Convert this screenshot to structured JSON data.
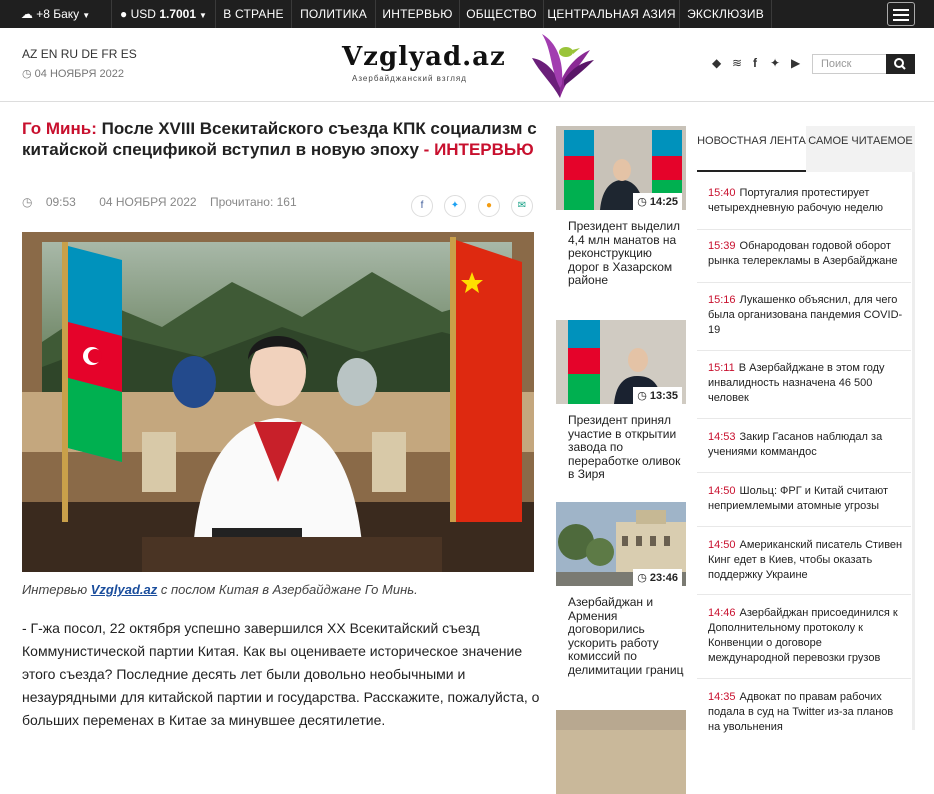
{
  "topbar": {
    "weather": "+8 Баку",
    "currency_label": "USD",
    "currency_value": "1.7001",
    "nav": [
      "В СТРАНЕ",
      "ПОЛИТИКА",
      "ИНТЕРВЬЮ",
      "ОБЩЕСТВО",
      "ЦЕНТРАЛЬНАЯ АЗИЯ",
      "ЭКСКЛЮЗИВ"
    ]
  },
  "header": {
    "languages": [
      "AZ",
      "EN",
      "RU",
      "DE",
      "FR",
      "ES"
    ],
    "date": "04 НОЯБРЯ 2022",
    "logo": "Vzglyad.az",
    "logo_sub": "Азербайджанский взгляд",
    "search_placeholder": "Поиск"
  },
  "article": {
    "author": "Го Минь:",
    "title": "После XVIII Всекитайского съезда КПК социализм с китайской спецификой вступил в новую эпоху",
    "dash": " - ",
    "rubric": "ИНТЕРВЬЮ",
    "time": "09:53",
    "date": "04 НОЯБРЯ 2022",
    "reads": "Прочитано: 161",
    "caption_pre": "Интервью ",
    "caption_link": "Vzglyad.az",
    "caption_post": " с послом Китая в Азербайджане Го Минь.",
    "body": "- Г-жа посол, 22 октября успешно завершился XX Всекитайский съезд Коммунистической партии Китая. Как вы оцениваете историческое значение этого съезда? Последние десять лет были довольно необычными и незаурядными для китайской партии и государства. Расскажите, пожалуйста, о больших переменах в Китае за минувшее десятилетие."
  },
  "middle": [
    {
      "time": "14:25",
      "text": "Президент выделил 4,4 млн манатов на реконструкцию дорог в Хазарском районе"
    },
    {
      "time": "13:35",
      "text": "Президент принял участие в открытии завода по переработке оливок в Зиря"
    },
    {
      "time": "23:46",
      "text": "Азербайджан и Армения договорились ускорить работу комиссий по делимитации границ"
    }
  ],
  "sidebar": {
    "tab_news": "НОВОСТНАЯ ЛЕНТА",
    "tab_popular": "САМОЕ ЧИТАЕМОЕ",
    "feed": [
      {
        "time": "15:40",
        "text": "Португалия протестирует четырехдневную рабочую неделю"
      },
      {
        "time": "15:39",
        "text": "Обнародован годовой оборот рынка телерекламы в Азербайджане"
      },
      {
        "time": "15:16",
        "text": "Лукашенко объяснил, для чего была организована пандемия COVID-19"
      },
      {
        "time": "15:11",
        "text": "В Азербайджане в этом году инвалидность назначена 46 500 человек"
      },
      {
        "time": "14:53",
        "text": "Закир Гасанов наблюдал за учениями коммандос"
      },
      {
        "time": "14:50",
        "text": "Шольц: ФРГ и Китай считают неприемлемыми атомные угрозы"
      },
      {
        "time": "14:50",
        "text": "Американский писатель Стивен Кинг едет в Киев, чтобы оказать поддержку Украине"
      },
      {
        "time": "14:46",
        "text": "Азербайджан присоединился к Дополнительному протоколу к Конвенции о договоре международной перевозки грузов"
      },
      {
        "time": "14:35",
        "text": "Адвокат по правам рабочих подала в суд на Twitter из-за планов на увольнения"
      }
    ]
  }
}
